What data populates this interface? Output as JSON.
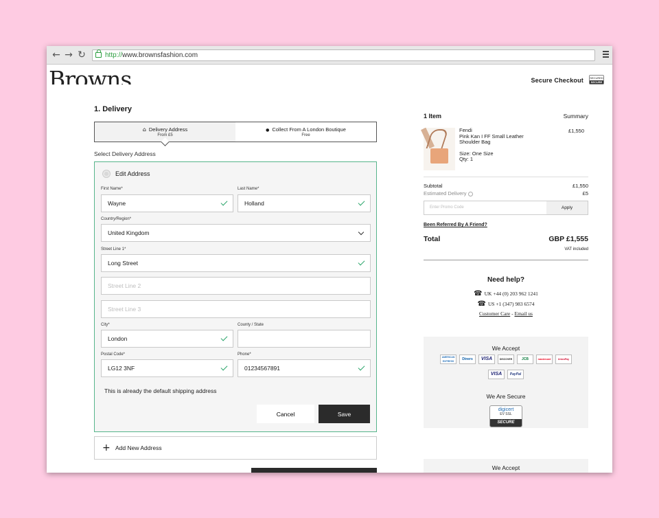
{
  "browser": {
    "url_scheme": "http://",
    "url_host": "www.brownsfashion.com",
    "back_glyph": "←",
    "forward_glyph": "→",
    "reload_glyph": "↻"
  },
  "header": {
    "logo": "Browns",
    "secure_checkout": "Secure Checkout",
    "badge_top": "SECURED",
    "badge_bottom": "SECURE"
  },
  "delivery": {
    "title": "1. Delivery",
    "tabs": [
      {
        "label": "Delivery Address",
        "sub": "From £5",
        "icon": "home-icon",
        "glyph": "⌂"
      },
      {
        "label": "Collect From A London Boutique",
        "sub": "Free",
        "icon": "location-pin-icon",
        "glyph": "●"
      }
    ],
    "select_label": "Select Delivery Address",
    "edit_address": "Edit Address",
    "fields": {
      "first_name": {
        "label": "First Name*",
        "value": "Wayne"
      },
      "last_name": {
        "label": "Last Name*",
        "value": "Holland"
      },
      "country": {
        "label": "Country/Region*",
        "value": "United Kingdom"
      },
      "street1": {
        "label": "Street Line 1*",
        "value": "Long Street"
      },
      "street2": {
        "placeholder": "Street Line 2"
      },
      "street3": {
        "placeholder": "Street Line 3"
      },
      "city": {
        "label": "City*",
        "value": "London"
      },
      "county": {
        "label": "County / State",
        "value": ""
      },
      "postal": {
        "label": "Postal Code*",
        "value": "LG12 3NF"
      },
      "phone": {
        "label": "Phone*",
        "value": "01234567891"
      }
    },
    "default_note": "This is already the default shipping address",
    "cancel": "Cancel",
    "save": "Save",
    "add_new": "Add New Address",
    "plus_glyph": "+"
  },
  "summary": {
    "items": "1 Item",
    "summary": "Summary",
    "product": {
      "brand": "Fendi",
      "name_line1": "Pink Kan I FF Small Leather",
      "name_line2": "Shoulder Bag",
      "size": "Size: One Size",
      "qty": "Qty: 1",
      "price": "£1,550"
    },
    "subtotal_label": "Subtotal",
    "subtotal_value": "£1,550",
    "est_delivery_label": "Estimated Delivery",
    "est_delivery_value": "£5",
    "promo_placeholder": "Enter Promo Code",
    "apply": "Apply",
    "referred": "Been Referred By A Friend?",
    "total_label": "Total",
    "total_value": "GBP £1,555",
    "vat": "VAT included",
    "need_help": "Need help?",
    "phone_uk": "UK +44 (0) 203 962 1241",
    "phone_us": "US +1 (347) 983 6574",
    "customer_care": "Customer Care",
    "care_sep": " - ",
    "email_us": "Email us",
    "we_accept": "We Accept",
    "we_are_secure": "We Are Secure",
    "cards": [
      "AMERICAN EXPRESS",
      "Diners",
      "VISA",
      "DISCOVER",
      "JCB",
      "mastercard",
      "UnionPay"
    ],
    "cards_row2": [
      "VISA",
      "PayPal"
    ],
    "digicert": "digicert",
    "digicert_sub": "EV SSL",
    "digicert_secure": "SECURE",
    "we_accept_2": "We Accept"
  },
  "colors": {
    "background": "#fecbe2",
    "accent_green": "#2aa56a",
    "dark_button": "#2b2b2b"
  }
}
